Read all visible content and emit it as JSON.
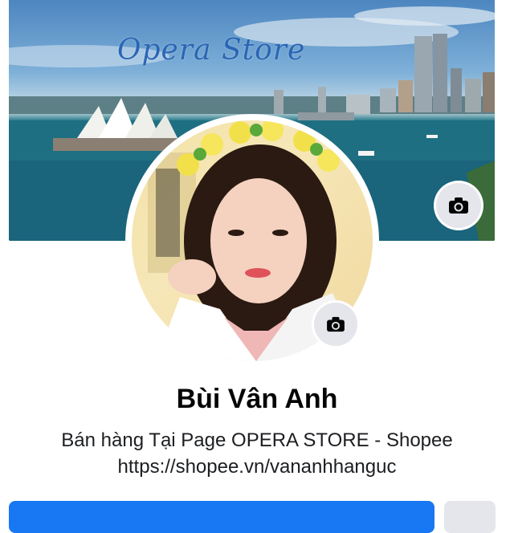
{
  "cover": {
    "title": "Opera Store",
    "camera_icon": "camera-icon"
  },
  "avatar": {
    "camera_icon": "camera-icon"
  },
  "profile": {
    "name": "Bùi Vân Anh",
    "bio_line1": "Bán hàng Tại Page OPERA STORE - Shopee",
    "bio_line2": "https://shopee.vn/vananhhanguc"
  },
  "colors": {
    "accent": "#1877f2",
    "secondary_button": "#e4e6eb",
    "text": "#050505"
  }
}
